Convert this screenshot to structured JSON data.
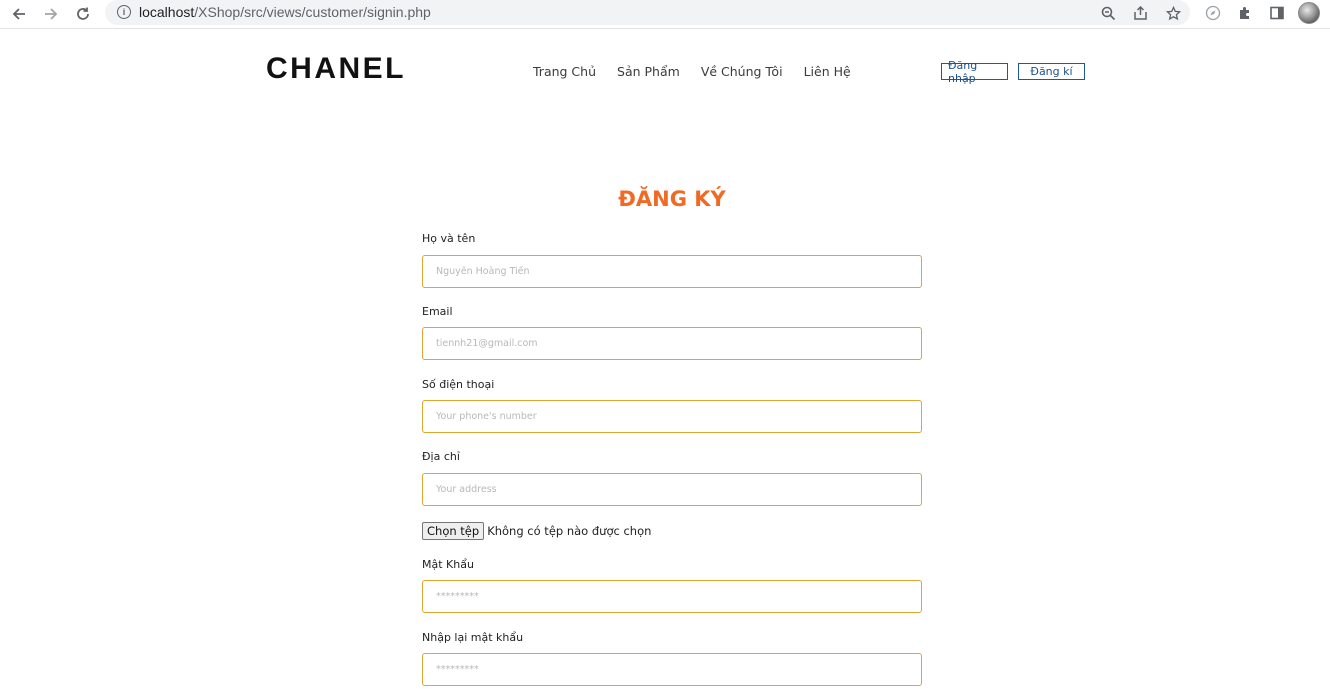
{
  "browser": {
    "url_host": "localhost",
    "url_path": "/XShop/src/views/customer/signin.php",
    "icons": [
      "back-arrow-icon",
      "forward-arrow-icon",
      "reload-icon",
      "info-icon",
      "zoom-icon",
      "share-icon",
      "star-icon",
      "compass-icon",
      "extensions-icon",
      "side-panel-icon",
      "profile-avatar"
    ]
  },
  "header": {
    "logo": "CHANEL",
    "nav": [
      "Trang Chủ",
      "Sản Phẩm",
      "Về Chúng Tôi",
      "Liên Hệ"
    ],
    "login_label": "Đăng nhập",
    "register_label": "Đăng kí"
  },
  "form": {
    "title": "ĐĂNG KÝ",
    "fields": [
      {
        "label": "Họ và tên",
        "placeholder": "Nguyễn Hoàng Tiến",
        "type": "text"
      },
      {
        "label": "Email",
        "placeholder": "tiennh21@gmail.com",
        "type": "email"
      },
      {
        "label": "Số điện thoại",
        "placeholder": "Your phone's number",
        "type": "text"
      },
      {
        "label": "Địa chỉ",
        "placeholder": "Your address",
        "type": "text"
      },
      {
        "label": "Mật Khẩu",
        "placeholder": "*********",
        "type": "text"
      },
      {
        "label": "Nhập lại mật khẩu",
        "placeholder": "*********",
        "type": "text"
      }
    ],
    "file": {
      "button_label": "Chọn tệp",
      "status": "Không có tệp nào được chọn"
    }
  },
  "colors": {
    "accent": "#f06a24",
    "input_border": "#e0a62e",
    "auth_border": "#1c5a9c"
  }
}
